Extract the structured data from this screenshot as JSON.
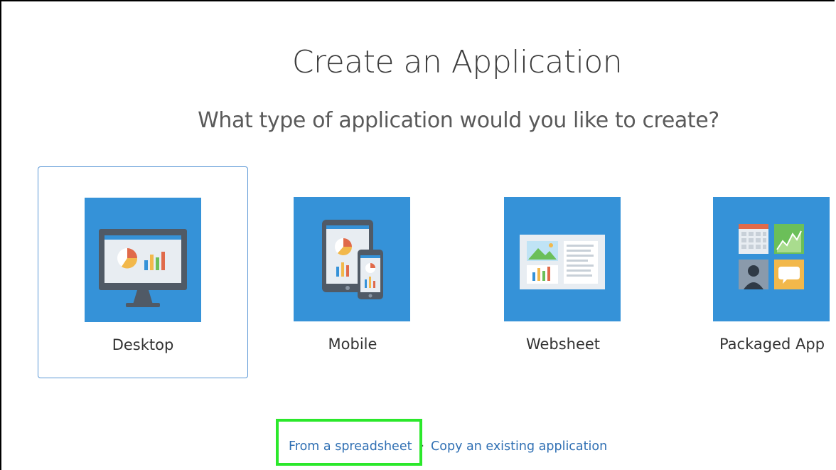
{
  "header": {
    "title": "Create an Application",
    "subtitle": "What type of application would you like to create?"
  },
  "cards": [
    {
      "label": "Desktop",
      "icon": "desktop-monitor-icon",
      "selected": true
    },
    {
      "label": "Mobile",
      "icon": "mobile-devices-icon",
      "selected": false
    },
    {
      "label": "Websheet",
      "icon": "websheet-icon",
      "selected": false
    },
    {
      "label": "Packaged App",
      "icon": "packaged-app-icon",
      "selected": false
    }
  ],
  "links": {
    "from_spreadsheet": "From a spreadsheet",
    "separator": "·",
    "copy_existing": "Copy an existing application"
  },
  "colors": {
    "tile_blue": "#3592d8",
    "link_blue": "#2f6fb3",
    "selected_border": "#5c98d6",
    "highlight_green": "#2be82b"
  }
}
